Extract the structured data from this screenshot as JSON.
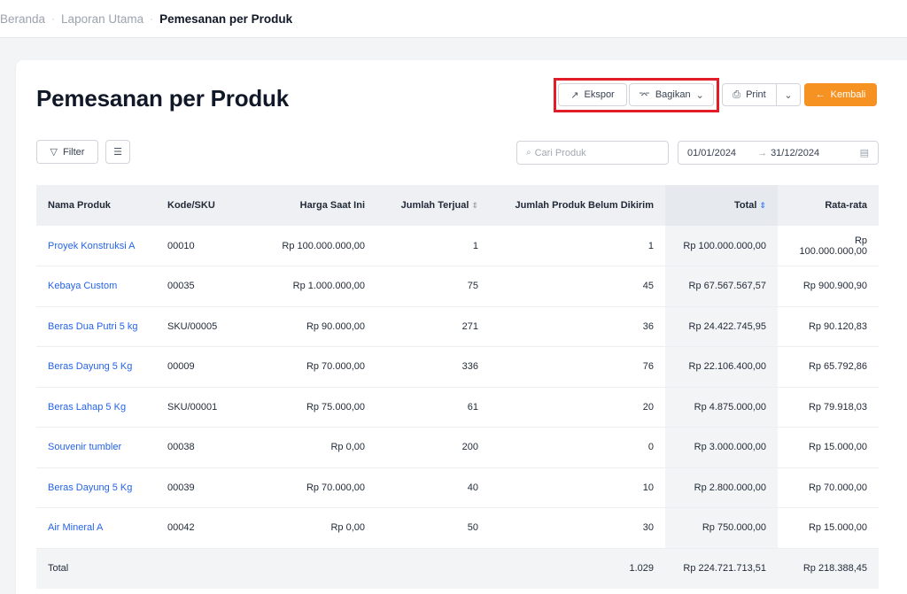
{
  "breadcrumb": {
    "items": [
      "Beranda",
      "Laporan Utama"
    ],
    "current": "Pemesanan per Produk",
    "separator": "·"
  },
  "page": {
    "title": "Pemesanan per Produk"
  },
  "toolbar": {
    "export_label": "Ekspor",
    "share_label": "Bagikan",
    "print_label": "Print",
    "back_label": "Kembali"
  },
  "filters": {
    "filter_label": "Filter",
    "search_placeholder": "Cari Produk",
    "date_from": "01/01/2024",
    "date_to": "31/12/2024"
  },
  "table": {
    "columns": {
      "name": "Nama Produk",
      "sku": "Kode/SKU",
      "price": "Harga Saat Ini",
      "sold": "Jumlah Terjual",
      "unshipped": "Jumlah Produk Belum Dikirim",
      "total": "Total",
      "average": "Rata-rata"
    },
    "rows": [
      {
        "name": "Proyek Konstruksi A",
        "sku": "00010",
        "price": "Rp 100.000.000,00",
        "sold": "1",
        "unshipped": "1",
        "total": "Rp 100.000.000,00",
        "average": "Rp 100.000.000,00"
      },
      {
        "name": "Kebaya Custom",
        "sku": "00035",
        "price": "Rp 1.000.000,00",
        "sold": "75",
        "unshipped": "45",
        "total": "Rp 67.567.567,57",
        "average": "Rp 900.900,90"
      },
      {
        "name": "Beras Dua Putri 5 kg",
        "sku": "SKU/00005",
        "price": "Rp 90.000,00",
        "sold": "271",
        "unshipped": "36",
        "total": "Rp 24.422.745,95",
        "average": "Rp 90.120,83"
      },
      {
        "name": "Beras Dayung 5 Kg",
        "sku": "00009",
        "price": "Rp 70.000,00",
        "sold": "336",
        "unshipped": "76",
        "total": "Rp 22.106.400,00",
        "average": "Rp 65.792,86"
      },
      {
        "name": "Beras Lahap 5 Kg",
        "sku": "SKU/00001",
        "price": "Rp 75.000,00",
        "sold": "61",
        "unshipped": "20",
        "total": "Rp 4.875.000,00",
        "average": "Rp 79.918,03"
      },
      {
        "name": "Souvenir tumbler",
        "sku": "00038",
        "price": "Rp 0,00",
        "sold": "200",
        "unshipped": "0",
        "total": "Rp 3.000.000,00",
        "average": "Rp 15.000,00"
      },
      {
        "name": "Beras Dayung 5 Kg",
        "sku": "00039",
        "price": "Rp 70.000,00",
        "sold": "40",
        "unshipped": "10",
        "total": "Rp 2.800.000,00",
        "average": "Rp 70.000,00"
      },
      {
        "name": "Air Mineral A",
        "sku": "00042",
        "price": "Rp 0,00",
        "sold": "50",
        "unshipped": "30",
        "total": "Rp 750.000,00",
        "average": "Rp 15.000,00"
      }
    ],
    "footer": {
      "label": "Total",
      "unshipped": "1.029",
      "total": "Rp 224.721.713,51",
      "average": "Rp 218.388,45"
    }
  },
  "colors": {
    "accent": "#f59221",
    "link": "#2563eb",
    "highlight": "#e11d2a"
  }
}
